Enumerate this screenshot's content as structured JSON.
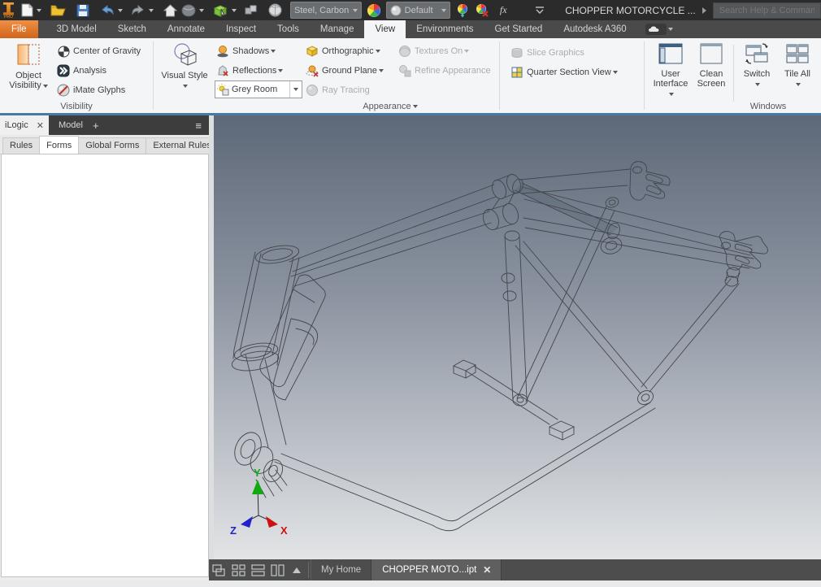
{
  "colors": {
    "accent_line": "#4779a3",
    "file_tab_orange": "#d0641a",
    "viewport_top": "#5d6878",
    "viewport_bottom": "#e2e4e6",
    "axis_x_color": "#cc1111",
    "axis_y_color": "#11aa11",
    "axis_z_color": "#2222cc"
  },
  "titlebar": {
    "logo_text": "PRO",
    "material_combo": "Steel, Carbon",
    "appearance_combo": "Default",
    "fx_label": "fx",
    "document_title": "CHOPPER MOTORCYCLE ...",
    "search_placeholder": "Search Help & Commands..."
  },
  "ribbon_tabs": [
    {
      "label": "File"
    },
    {
      "label": "3D Model"
    },
    {
      "label": "Sketch"
    },
    {
      "label": "Annotate"
    },
    {
      "label": "Inspect"
    },
    {
      "label": "Tools"
    },
    {
      "label": "Manage"
    },
    {
      "label": "View"
    },
    {
      "label": "Environments"
    },
    {
      "label": "Get Started"
    },
    {
      "label": "Autodesk A360"
    }
  ],
  "ribbon": {
    "visibility": {
      "big_button": "Object Visibility",
      "items": [
        "Center of Gravity",
        "Analysis",
        "iMate Glyphs"
      ],
      "label": "Visibility"
    },
    "appearance": {
      "big_button": "Visual Style",
      "shadows": "Shadows",
      "reflections": "Reflections",
      "room_combo": "Grey Room",
      "orthographic": "Orthographic",
      "ground_plane": "Ground Plane",
      "ray_tracing": "Ray Tracing",
      "textures_on": "Textures On",
      "refine_appearance": "Refine Appearance",
      "label": "Appearance"
    },
    "section": {
      "slice_graphics": "Slice Graphics",
      "quarter_section": "Quarter Section View"
    },
    "windows": {
      "user_interface": "User Interface",
      "clean_screen": "Clean Screen",
      "switch": "Switch",
      "tile_all": "Tile All",
      "label": "Windows"
    }
  },
  "ilogic": {
    "panel_title": "iLogic",
    "model_tab": "Model",
    "add_tab": "+",
    "menu_icon": "≡",
    "tabs": [
      "Rules",
      "Forms",
      "Global Forms",
      "External Rules"
    ],
    "active_tab": "Forms"
  },
  "viewport": {
    "axis": {
      "x": "X",
      "y": "Y",
      "z": "Z"
    }
  },
  "bottombar": {
    "home_tab": "My Home",
    "document_tab": "CHOPPER MOTO...ipt"
  }
}
